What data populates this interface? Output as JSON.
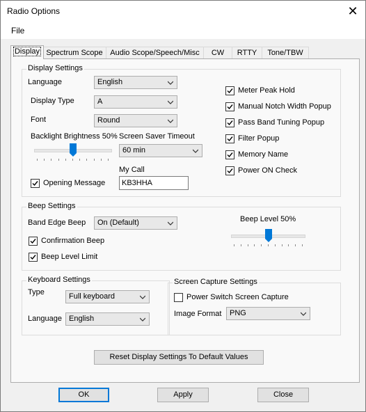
{
  "window": {
    "title": "Radio Options"
  },
  "menu": {
    "file": "File"
  },
  "tabs": [
    {
      "label": "Display"
    },
    {
      "label": "Spectrum Scope"
    },
    {
      "label": "Audio Scope/Speech/Misc"
    },
    {
      "label": "CW"
    },
    {
      "label": "RTTY"
    },
    {
      "label": "Tone/TBW"
    }
  ],
  "display_settings": {
    "title": "Display Settings",
    "language_label": "Language",
    "language_value": "English",
    "display_type_label": "Display Type",
    "display_type_value": "A",
    "font_label": "Font",
    "font_value": "Round",
    "backlight_label": "Backlight Brightness 50%",
    "backlight_value": 0.5,
    "screen_saver_label": "Screen Saver Timeout",
    "screen_saver_value": "60 min",
    "opening_message_label": "Opening Message",
    "opening_message_checked": true,
    "my_call_label": "My Call",
    "my_call_value": "KB3HHA",
    "checkboxes": [
      {
        "label": "Meter Peak Hold",
        "checked": true
      },
      {
        "label": "Manual Notch Width Popup",
        "checked": true
      },
      {
        "label": "Pass Band Tuning Popup",
        "checked": true
      },
      {
        "label": "Filter Popup",
        "checked": true
      },
      {
        "label": "Memory Name",
        "checked": true
      },
      {
        "label": "Power ON Check",
        "checked": true
      }
    ]
  },
  "beep_settings": {
    "title": "Beep Settings",
    "band_edge_label": "Band Edge Beep",
    "band_edge_value": "On (Default)",
    "confirmation_label": "Confirmation Beep",
    "confirmation_checked": true,
    "level_limit_label": "Beep Level Limit",
    "level_limit_checked": true,
    "beep_level_label": "Beep Level 50%",
    "beep_level_value": 0.5
  },
  "keyboard_settings": {
    "title": "Keyboard Settings",
    "type_label": "Type",
    "type_value": "Full keyboard",
    "language_label": "Language",
    "language_value": "English"
  },
  "screen_capture": {
    "title": "Screen Capture Settings",
    "power_switch_label": "Power Switch Screen Capture",
    "power_switch_checked": false,
    "format_label": "Image Format",
    "format_value": "PNG"
  },
  "reset_button": "Reset Display Settings To Default Values",
  "buttons": {
    "ok": "OK",
    "apply": "Apply",
    "close": "Close"
  }
}
